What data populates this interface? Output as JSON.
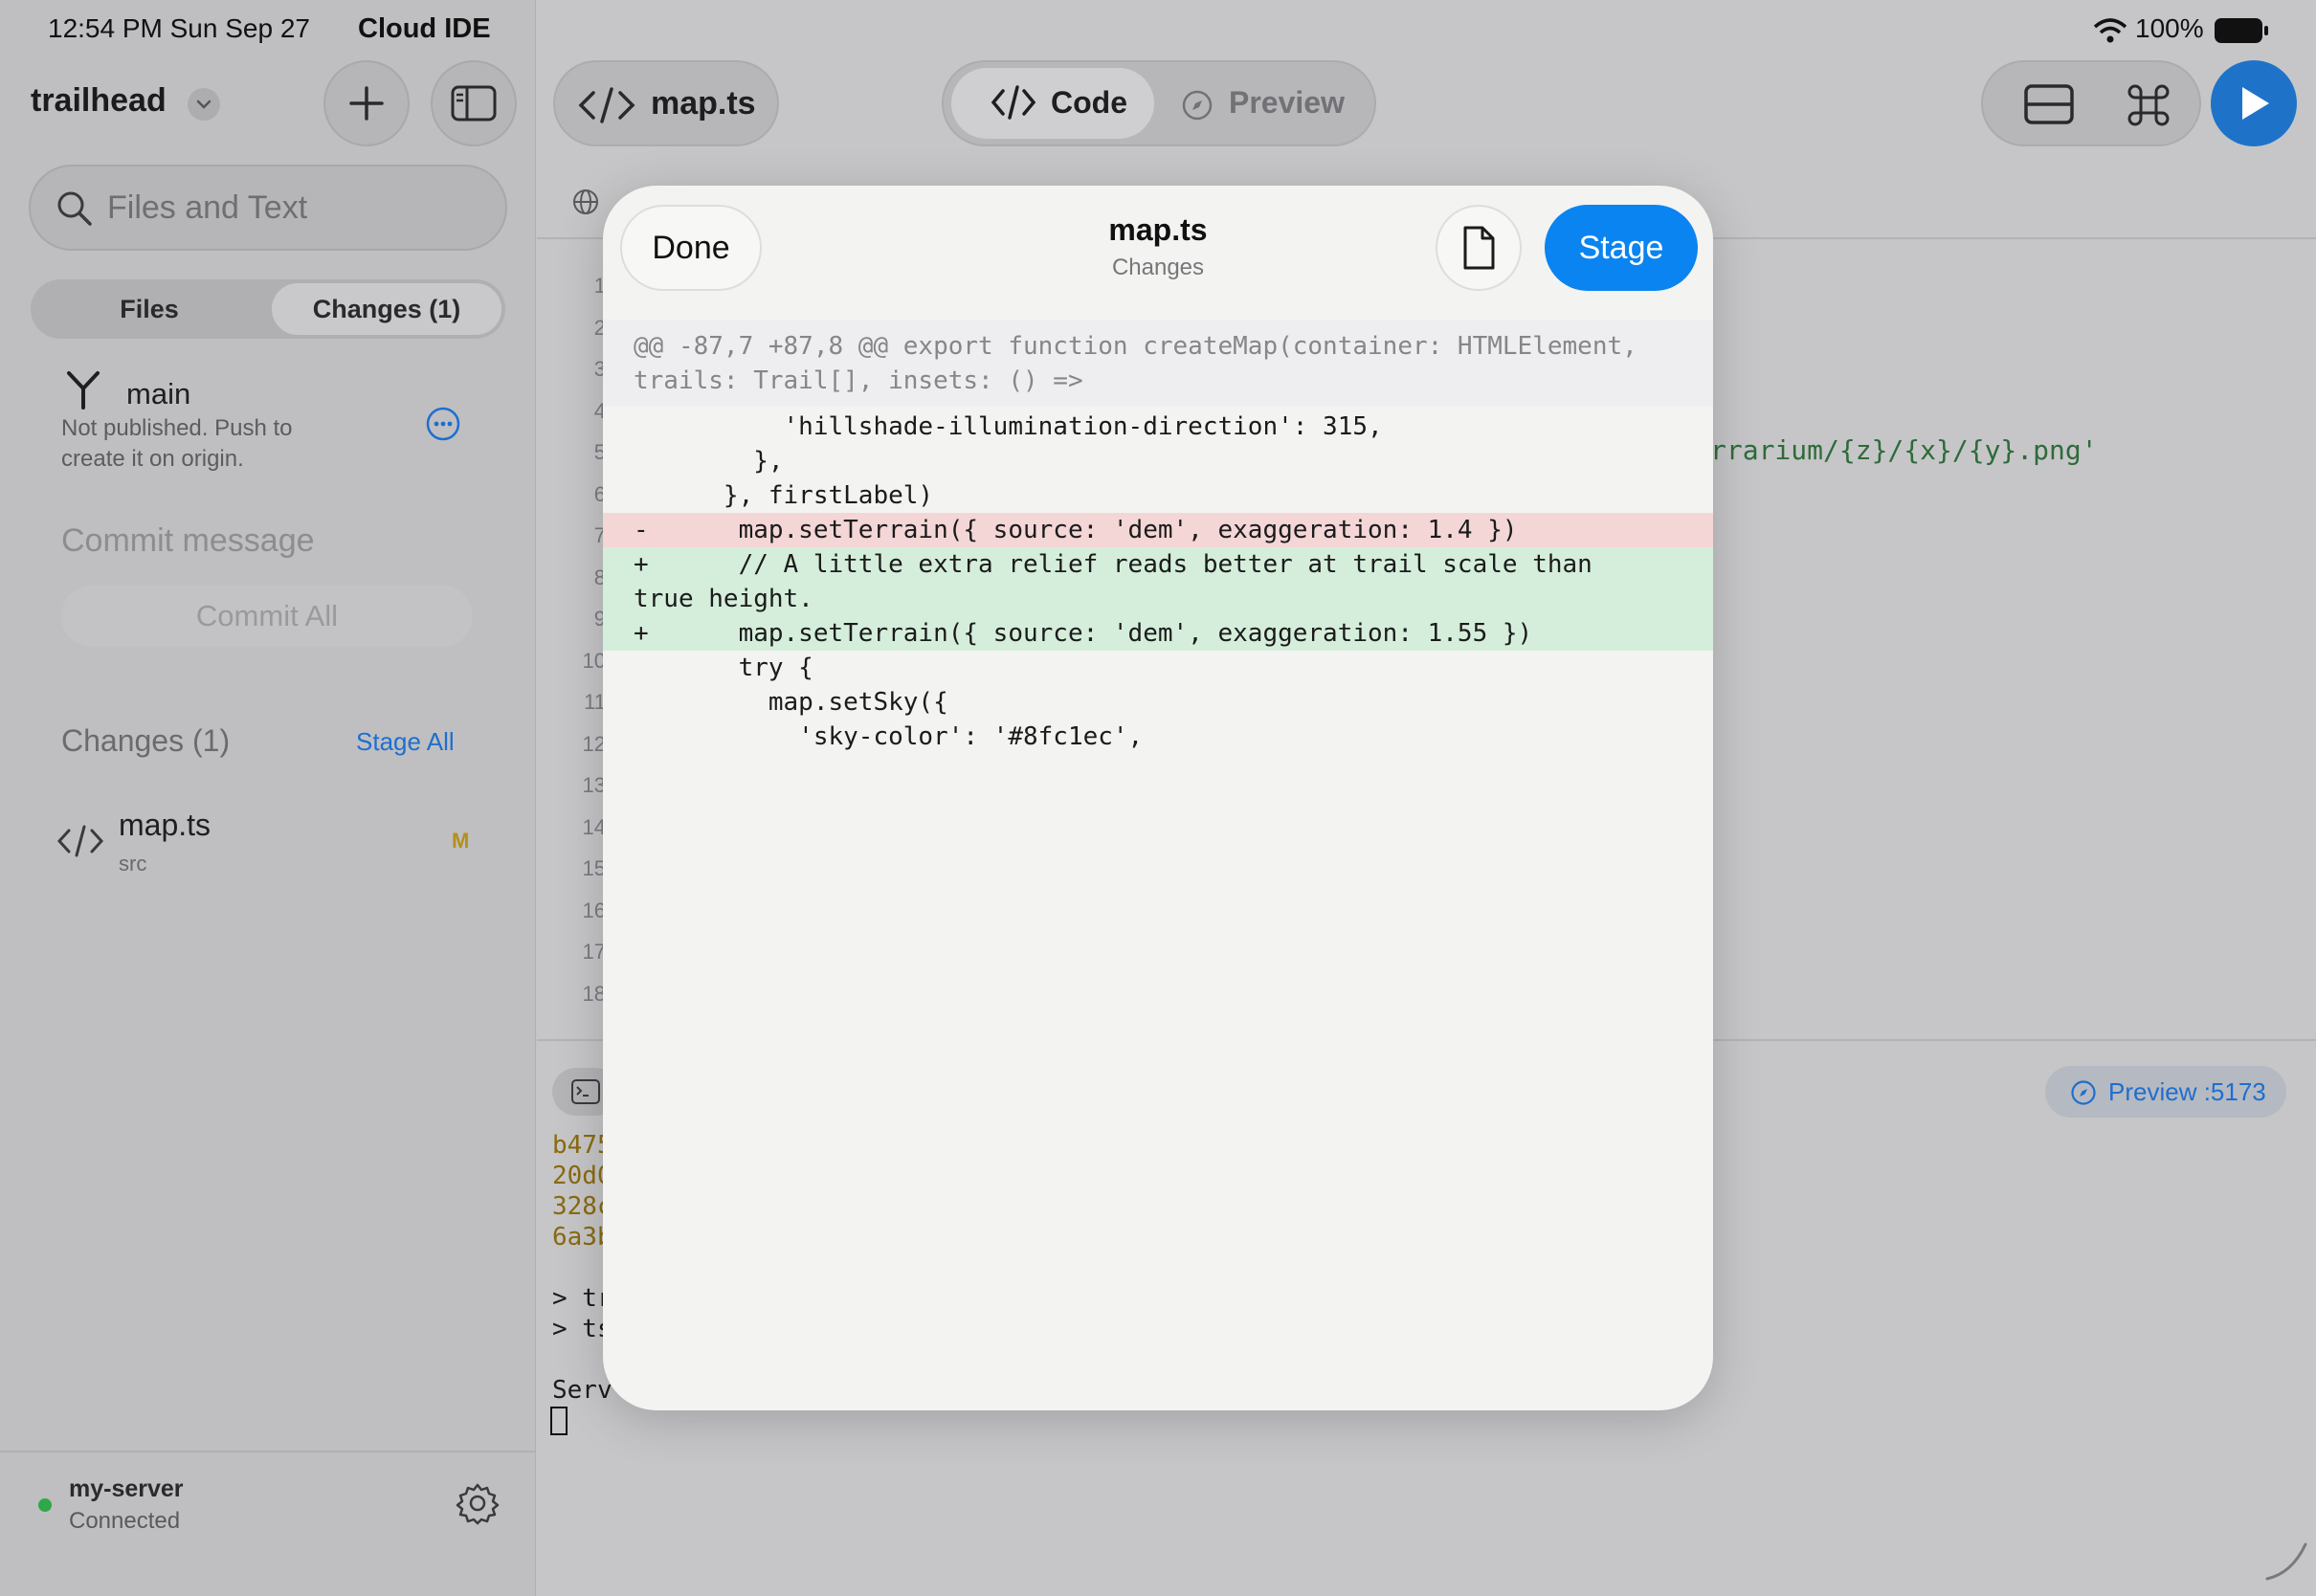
{
  "status_bar": {
    "time": "12:54 PM   Sun Sep 27",
    "app_name": "Cloud IDE",
    "battery": "100%"
  },
  "sidebar": {
    "project_name": "trailhead",
    "search_placeholder": "Files and Text",
    "tabs": [
      {
        "label": "Files"
      },
      {
        "label": "Changes (1)"
      }
    ],
    "branch": {
      "name": "main",
      "note": "Not published. Push to create it on origin."
    },
    "commit_placeholder": "Commit message",
    "commit_button": "Commit All",
    "changes_header": "Changes (1)",
    "stage_all": "Stage All",
    "changed_files": [
      {
        "name": "map.ts",
        "dir": "src",
        "status": "M"
      }
    ],
    "server": {
      "name": "my-server",
      "status": "Connected"
    }
  },
  "toolbar": {
    "file_tab": "map.ts",
    "code_label": "Code",
    "preview_label": "Preview"
  },
  "editor": {
    "line_numbers": [
      "1",
      "2",
      "3",
      "4",
      "5",
      "6",
      "7",
      "8",
      "9",
      "10",
      "11",
      "12",
      "13",
      "14",
      "15",
      "16",
      "17",
      "18"
    ],
    "visible_code_fragment": "rrarium/{z}/{x}/{y}.png'"
  },
  "terminal": {
    "lines": [
      "b475",
      "20d0",
      "328c",
      "6a3b",
      "",
      "> tr",
      "> ts",
      "",
      "Serv"
    ],
    "preview_port": "Preview :5173"
  },
  "modal": {
    "done_label": "Done",
    "title": "map.ts",
    "subtitle": "Changes",
    "stage_label": "Stage",
    "hunk_header": "@@ -87,7 +87,8 @@ export function createMap(container: HTMLElement, trails: Trail[], insets: () =>",
    "diff_lines": [
      {
        "type": "ctx",
        "text": "          'hillshade-illumination-direction': 315,"
      },
      {
        "type": "ctx",
        "text": "        },"
      },
      {
        "type": "ctx",
        "text": "      }, firstLabel)"
      },
      {
        "type": "del",
        "text": "-      map.setTerrain({ source: 'dem', exaggeration: 1.4 })"
      },
      {
        "type": "add",
        "text": "+      // A little extra relief reads better at trail scale than\ntrue height."
      },
      {
        "type": "add",
        "text": "+      map.setTerrain({ source: 'dem', exaggeration: 1.55 })"
      },
      {
        "type": "ctx",
        "text": "       try {"
      },
      {
        "type": "ctx",
        "text": "         map.setSky({"
      },
      {
        "type": "ctx",
        "text": "           'sky-color': '#8fc1ec',"
      }
    ]
  },
  "colors": {
    "accent": "#0a84f0",
    "deleted_bg": "#f4d6d6",
    "added_bg": "#d5eedb",
    "modified": "#b58f18"
  }
}
